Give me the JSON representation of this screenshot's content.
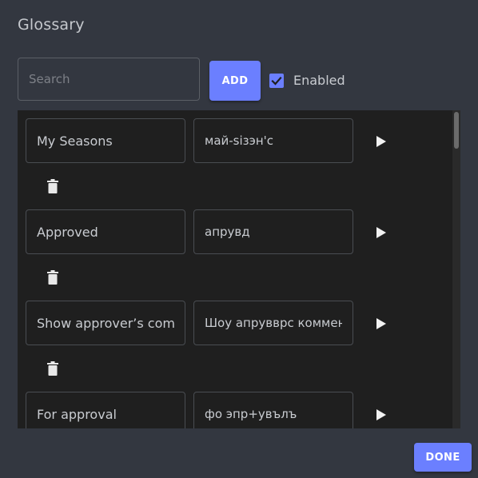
{
  "dialog": {
    "title": "Glossary"
  },
  "toolbar": {
    "search_value": "",
    "search_placeholder": "Search",
    "add_label": "ADD",
    "enabled_checked": true,
    "enabled_label": "Enabled"
  },
  "entries": [
    {
      "source": "My Seasons",
      "target": "май-sізэн'с"
    },
    {
      "source": "Approved",
      "target": "апрувд"
    },
    {
      "source": "Show approver’s comment",
      "target": "Шоу апрувврс коммент"
    },
    {
      "source": "For approval",
      "target": "фо эпр+увълъ"
    }
  ],
  "footer": {
    "done_label": "DONE"
  },
  "colors": {
    "accent": "#6b7fff",
    "background": "#333740",
    "list_background": "#1f1f1f"
  },
  "icons": {
    "play": "play-icon",
    "delete": "trash-icon",
    "check": "check-icon"
  }
}
